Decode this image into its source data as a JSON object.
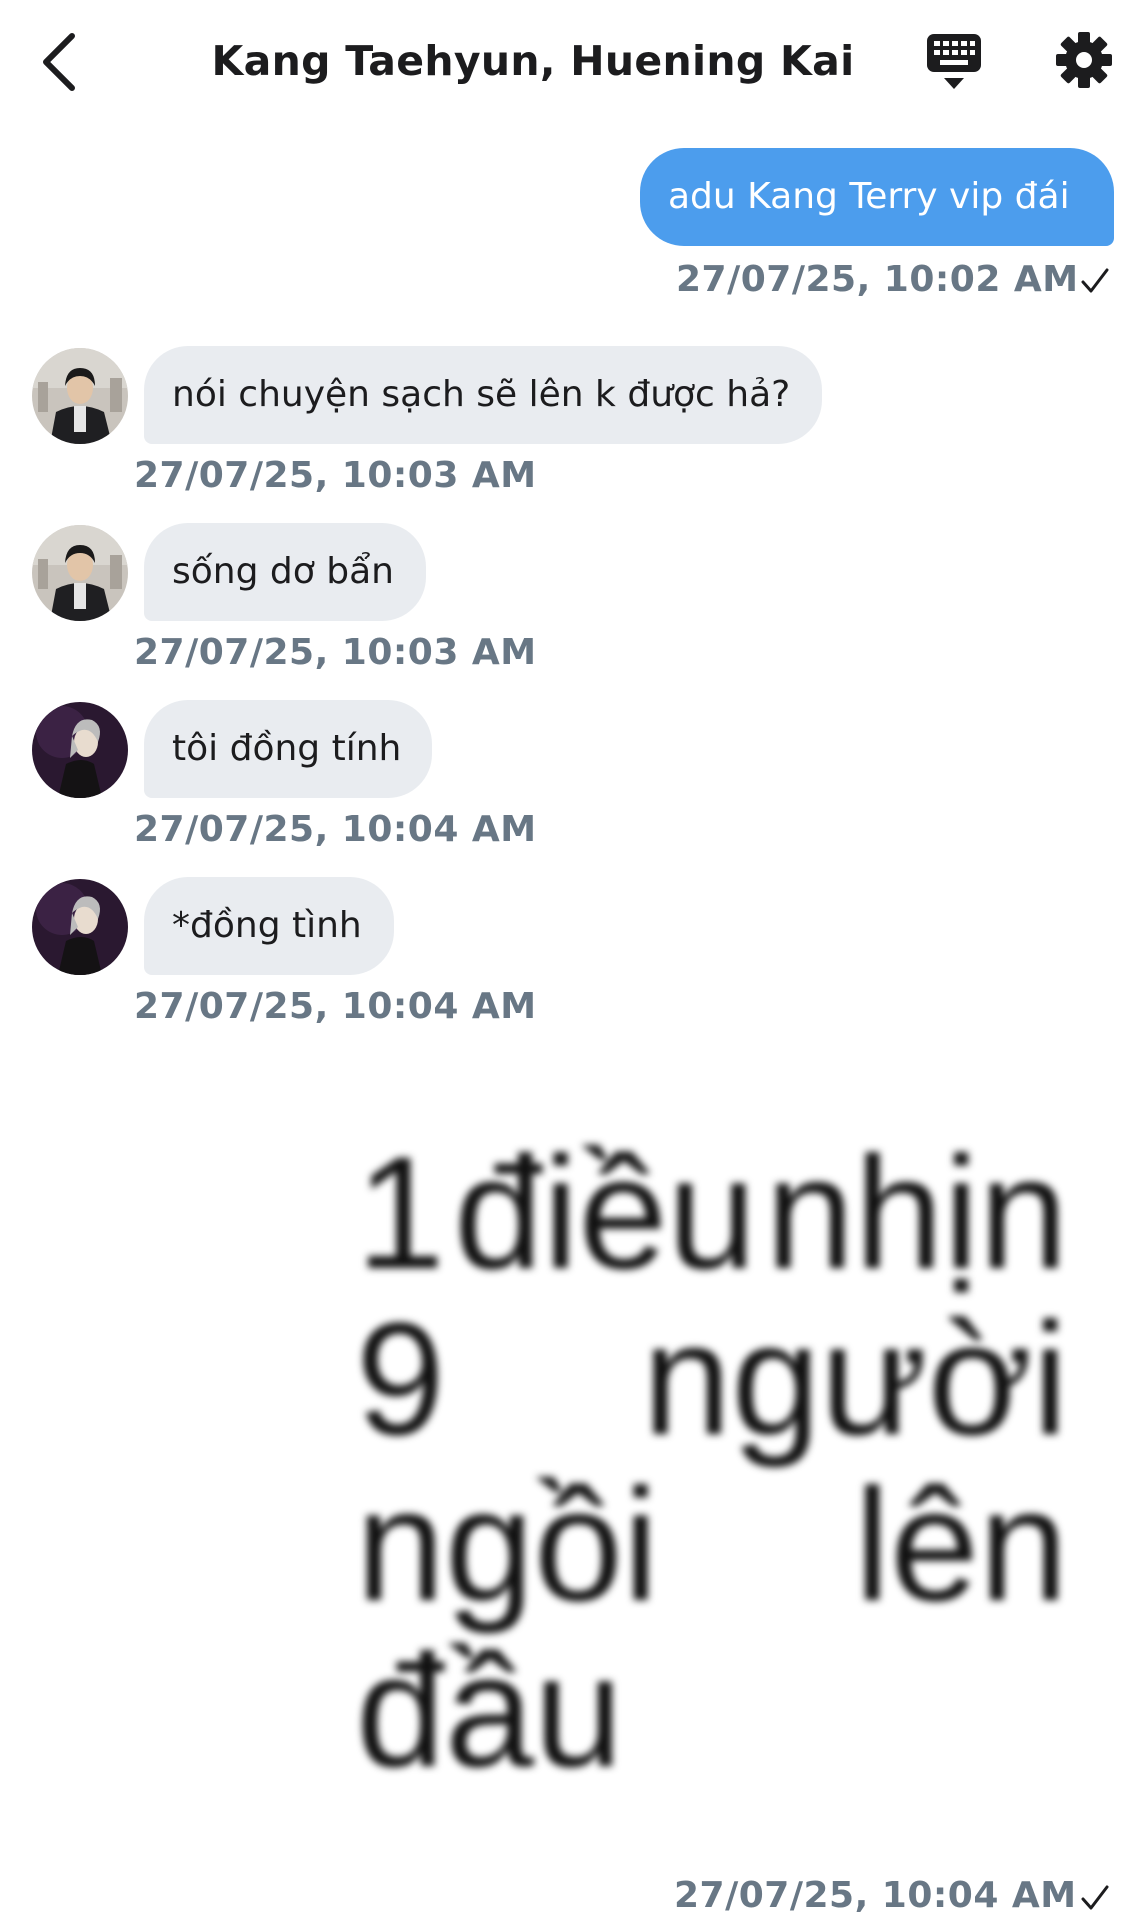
{
  "header": {
    "title": "Kang Taehyun, Huening Kai",
    "back_icon": "chevron-left-icon",
    "keyboard_icon": "keyboard-icon",
    "settings_icon": "gear-icon"
  },
  "messages": [
    {
      "direction": "outgoing",
      "text": "adu Kang Terry vip đái",
      "time": "27/07/25, 10:02 AM",
      "status": "sent"
    },
    {
      "direction": "incoming",
      "sender_avatar": "avatar-1",
      "text": "nói chuyện sạch sẽ lên k được hả?",
      "time": "27/07/25, 10:03 AM"
    },
    {
      "direction": "incoming",
      "sender_avatar": "avatar-1",
      "text": "sống dơ bẩn",
      "time": "27/07/25, 10:03 AM"
    },
    {
      "direction": "incoming",
      "sender_avatar": "avatar-2",
      "text": "tôi đồng tính",
      "time": "27/07/25, 10:04 AM"
    },
    {
      "direction": "incoming",
      "sender_avatar": "avatar-2",
      "text": "*đồng tình",
      "time": "27/07/25, 10:04 AM"
    }
  ],
  "image_message": {
    "direction": "outgoing",
    "lines": [
      {
        "words": [
          "1",
          "điều",
          "nhịn"
        ]
      },
      {
        "words": [
          "9",
          "người"
        ]
      },
      {
        "words": [
          "ngồi",
          "lên"
        ]
      },
      {
        "words": [
          "đầu"
        ]
      }
    ],
    "time": "27/07/25, 10:04 AM",
    "status": "sent"
  },
  "colors": {
    "outgoing_bubble": "#4c9ded",
    "incoming_bubble": "#e9ecf0",
    "timestamp": "#687785"
  }
}
